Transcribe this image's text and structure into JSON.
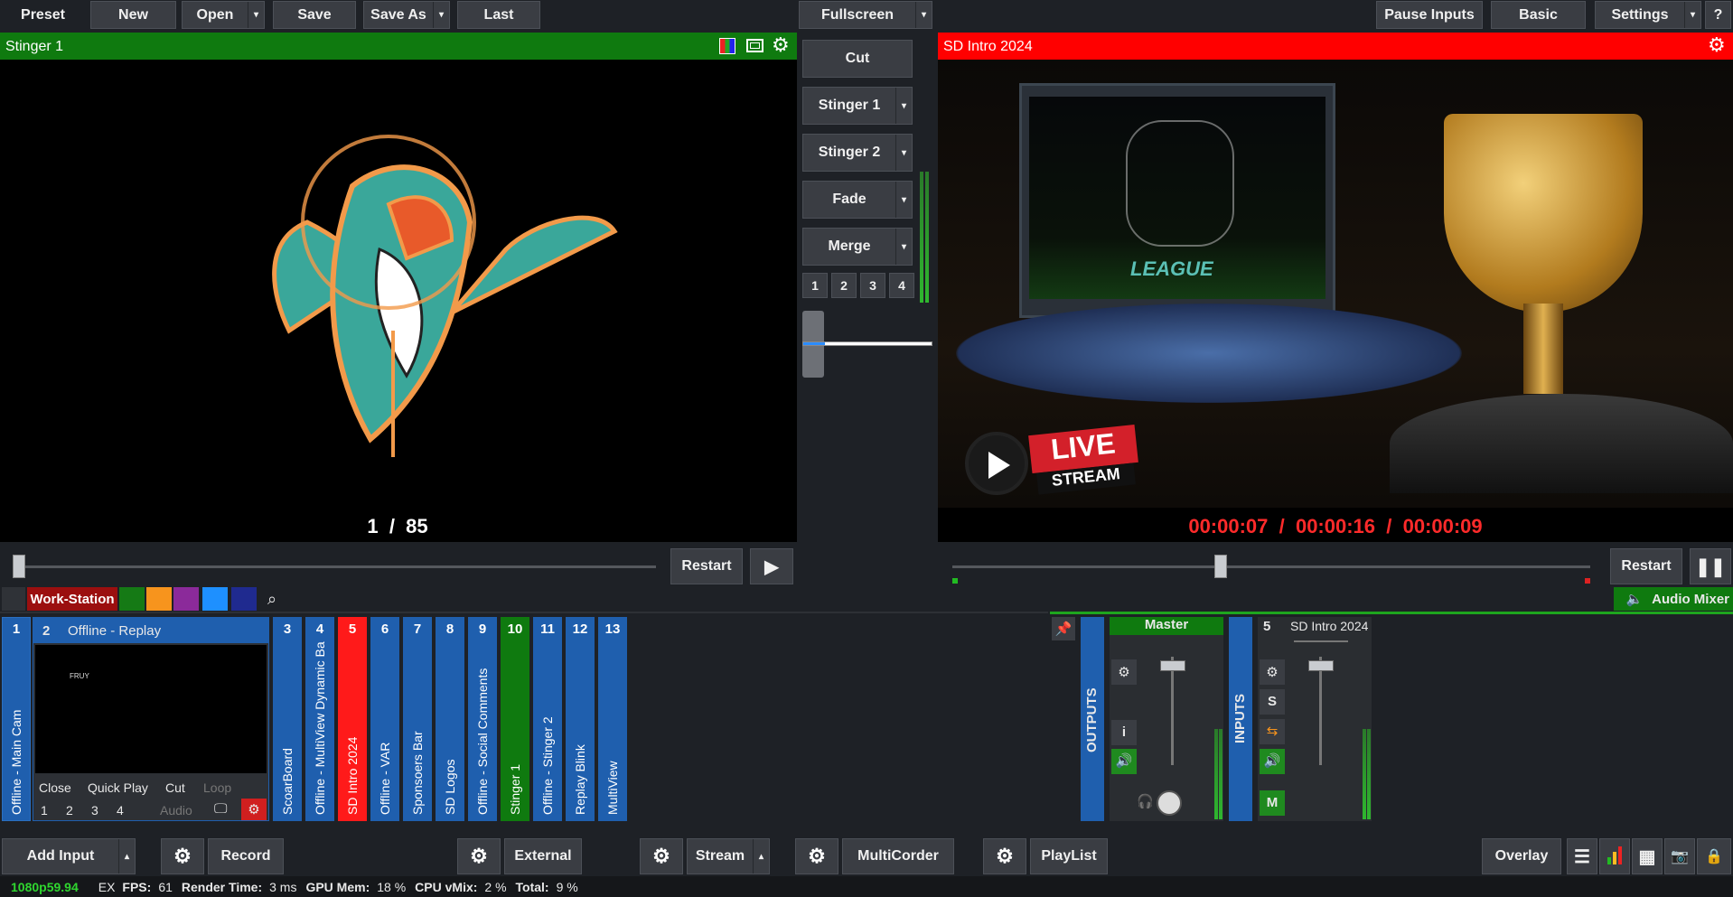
{
  "toolbar": {
    "preset": "Preset",
    "new": "New",
    "open": "Open",
    "save": "Save",
    "save_as": "Save As",
    "last": "Last",
    "fullscreen": "Fullscreen",
    "pause_inputs": "Pause Inputs",
    "basic": "Basic",
    "settings": "Settings",
    "help": "?"
  },
  "preview": {
    "title": "Stinger 1",
    "counter": "1  /  85",
    "restart": "Restart"
  },
  "output": {
    "title": "SD Intro 2024",
    "times": "00:00:07  /  00:00:16  /  00:00:09",
    "restart": "Restart",
    "position": 0.43,
    "live_text": "LIVE",
    "stream_text": "STREAM",
    "league_text": "LEAGUE"
  },
  "transitions": {
    "cut": "Cut",
    "stinger1": "Stinger 1",
    "stinger2": "Stinger 2",
    "fade": "Fade",
    "merge": "Merge",
    "nums": [
      "1",
      "2",
      "3",
      "4"
    ]
  },
  "tabs": {
    "workstation": "Work-Station",
    "colors": [
      "#157a15",
      "#f7941d",
      "#8b2a9a",
      "#1e90ff",
      "#1f2a8f"
    ]
  },
  "inputs": {
    "selected": {
      "num": "2",
      "title": "Offline - Replay",
      "thumb_text": "FRUY",
      "close": "Close",
      "quick_play": "Quick Play",
      "cut": "Cut",
      "loop": "Loop",
      "nums": [
        "1",
        "2",
        "3",
        "4"
      ],
      "audio": "Audio"
    },
    "first": {
      "num": "1",
      "label": "Offline - Main Cam"
    },
    "tiles": [
      {
        "num": "3",
        "label": "ScoarBoard",
        "color": "#1f5fae"
      },
      {
        "num": "4",
        "label": "Offline - MultiView Dynamic Ba",
        "color": "#1f5fae"
      },
      {
        "num": "5",
        "label": "SD Intro 2024",
        "color": "#ff1a1a"
      },
      {
        "num": "6",
        "label": "Offline - VAR",
        "color": "#1f5fae"
      },
      {
        "num": "7",
        "label": "Sponsoers Bar",
        "color": "#1f5fae"
      },
      {
        "num": "8",
        "label": "SD Logos",
        "color": "#1f5fae"
      },
      {
        "num": "9",
        "label": "Offline - Social Comments",
        "color": "#1f5fae"
      },
      {
        "num": "10",
        "label": "Stinger 1",
        "color": "#0f7a0f"
      },
      {
        "num": "11",
        "label": "Offline - Stinger 2",
        "color": "#1f5fae"
      },
      {
        "num": "12",
        "label": "Replay Blink",
        "color": "#1f5fae"
      },
      {
        "num": "13",
        "label": "MultiView",
        "color": "#1f5fae"
      }
    ]
  },
  "audio": {
    "mixer_label": "Audio Mixer",
    "outputs": "OUTPUTS",
    "inputs": "INPUTS",
    "master": "Master",
    "channel_num": "5",
    "channel_name": "SD Intro 2024",
    "info": "i",
    "solo": "S",
    "mute": "M"
  },
  "bottom": {
    "add_input": "Add Input",
    "record": "Record",
    "external": "External",
    "stream": "Stream",
    "multicorder": "MultiCorder",
    "playlist": "PlayList",
    "overlay": "Overlay"
  },
  "status": {
    "format": "1080p59.94",
    "ex": "EX",
    "fps_label": "FPS:",
    "fps": "61",
    "render_label": "Render Time:",
    "render": "3 ms",
    "gpu_label": "GPU Mem:",
    "gpu": "18 %",
    "cpu_label": "CPU vMix:",
    "cpu": "2 %",
    "total_label": "Total:",
    "total": "9 %"
  }
}
